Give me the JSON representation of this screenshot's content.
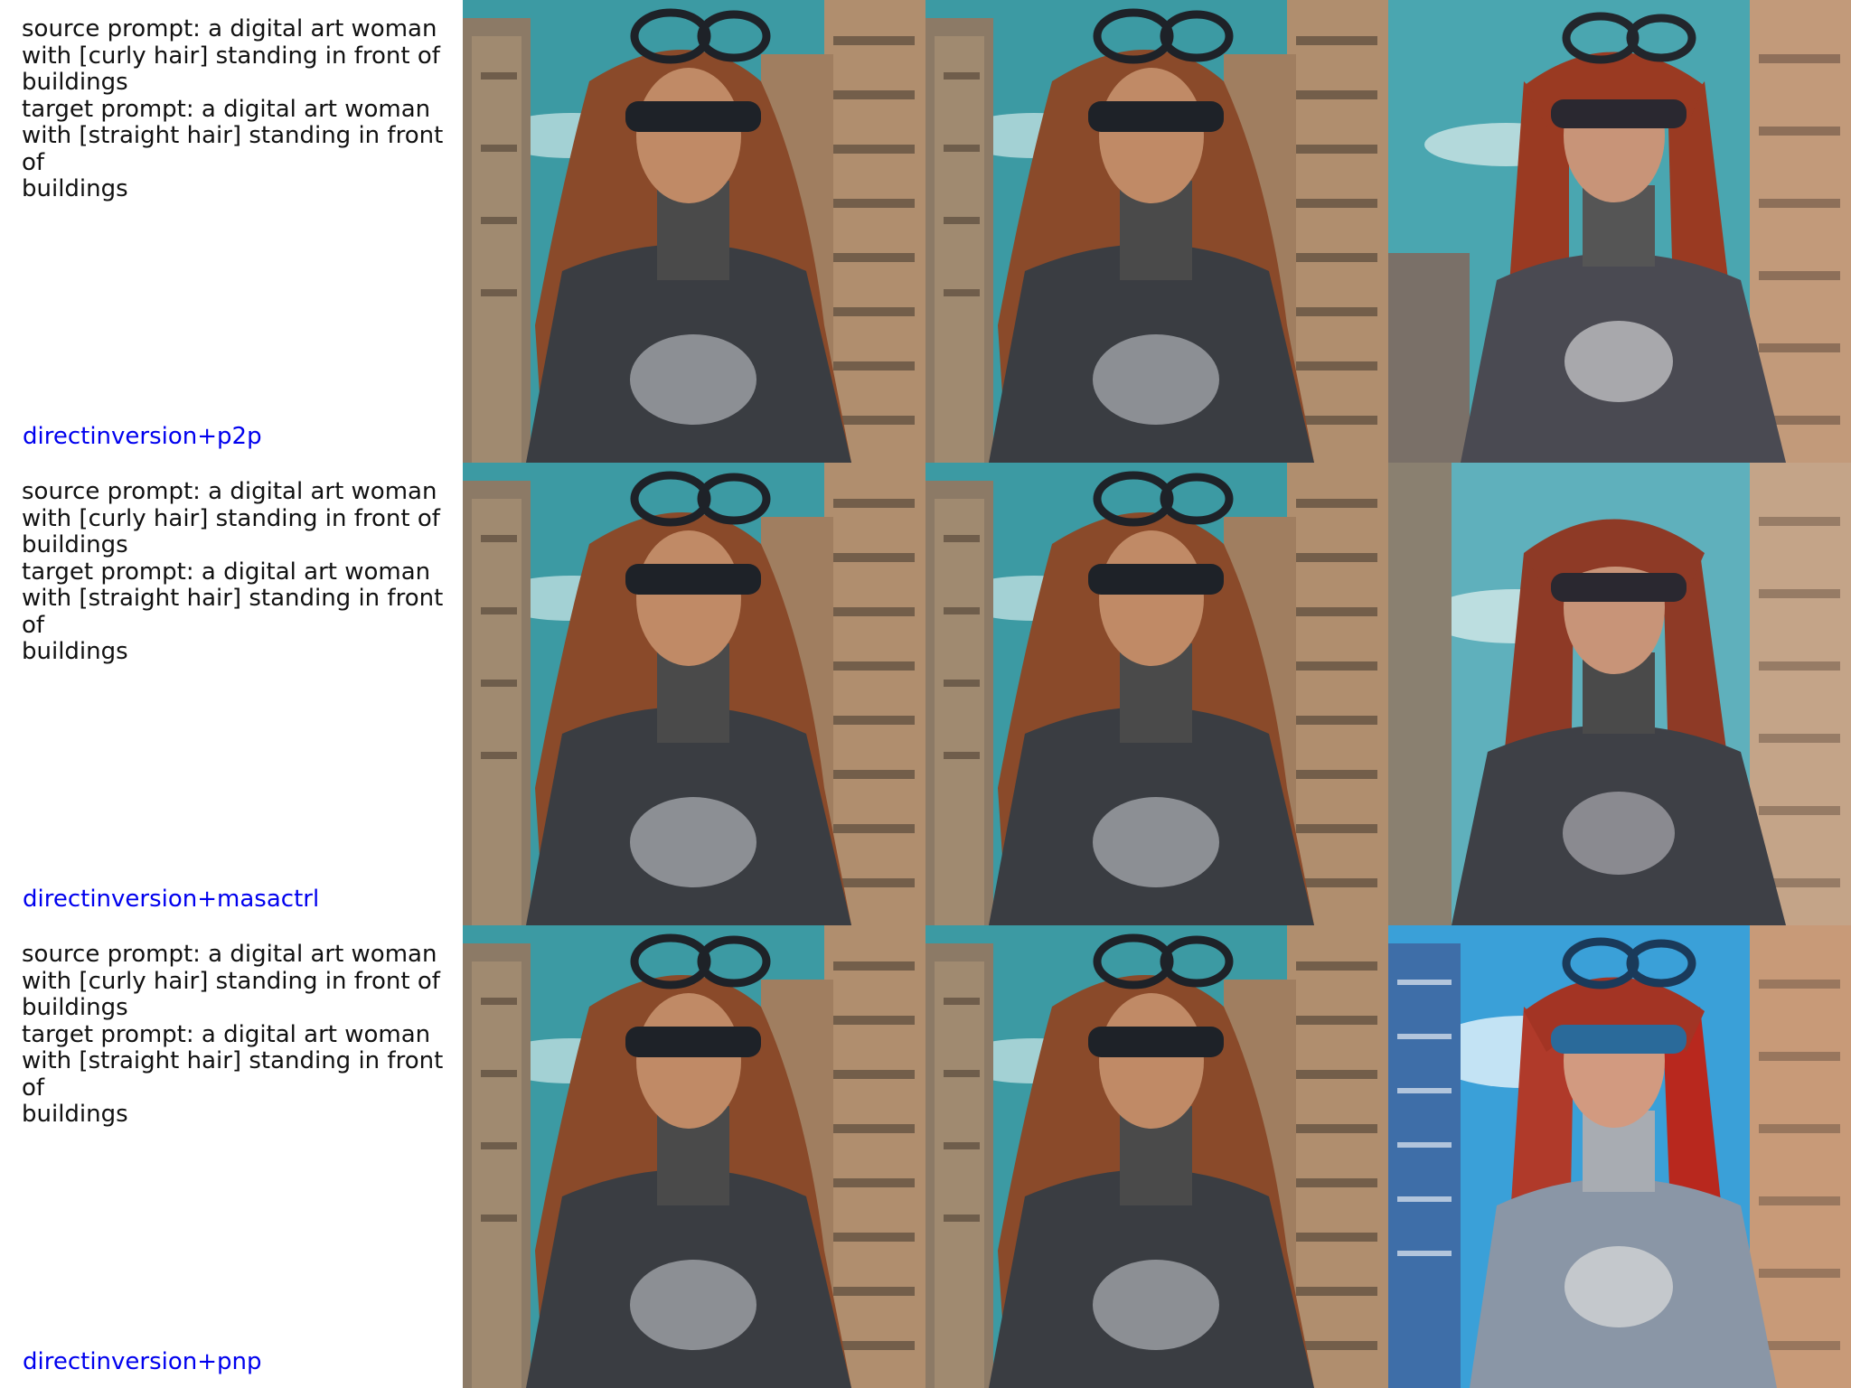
{
  "rows": [
    {
      "source_prompt": "source prompt: a digital art woman\nwith [curly hair] standing in front of\nbuildings",
      "target_prompt": "target prompt: a digital art woman\nwith [straight hair] standing in front of\nbuildings",
      "method": "directinversion+p2p"
    },
    {
      "source_prompt": "source prompt: a digital art woman\nwith [curly hair] standing in front of\nbuildings",
      "target_prompt": "target prompt: a digital art woman\nwith [straight hair] standing in front of\nbuildings",
      "method": "directinversion+masactrl"
    },
    {
      "source_prompt": "source prompt: a digital art woman\nwith [curly hair] standing in front of\nbuildings",
      "target_prompt": "target prompt: a digital art woman\nwith [straight hair] standing in front of\nbuildings",
      "method": "directinversion+pnp"
    }
  ],
  "colors": {
    "method_label": "#0000ee",
    "sky_teal": "#2f8f9a",
    "sky_blue": "#3aa0d8",
    "building": "#b08e6e",
    "hair_curly": "#8a4a2a",
    "hair_straight": "#9a3a22",
    "armor": "#3a3d42"
  }
}
